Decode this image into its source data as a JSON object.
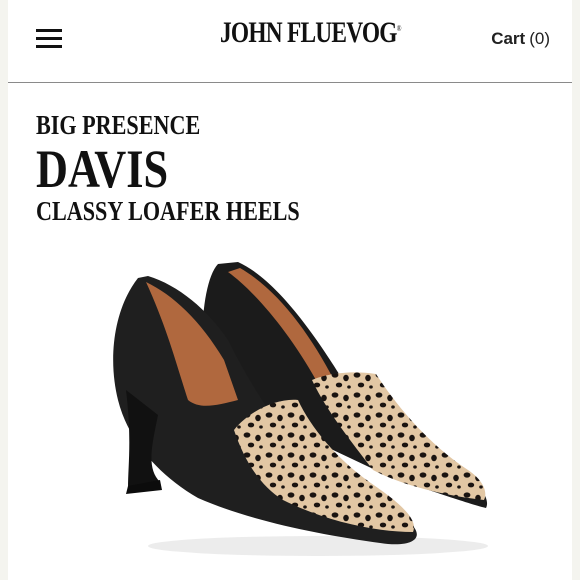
{
  "header": {
    "menu_icon": "hamburger-menu-icon",
    "logo_text": "JOHN FLUEVOG",
    "logo_mark": "®",
    "cart_label": "Cart",
    "cart_count": "(0)"
  },
  "product": {
    "collection": "BIG PRESENCE",
    "name": "DAVIS",
    "tagline": "CLASSY LOAFER HEELS"
  },
  "colors": {
    "background": "#ffffff",
    "text": "#111111",
    "leather": "#1b1b1b",
    "lining": "#b0683e",
    "spots_base": "#e2c7a4"
  }
}
